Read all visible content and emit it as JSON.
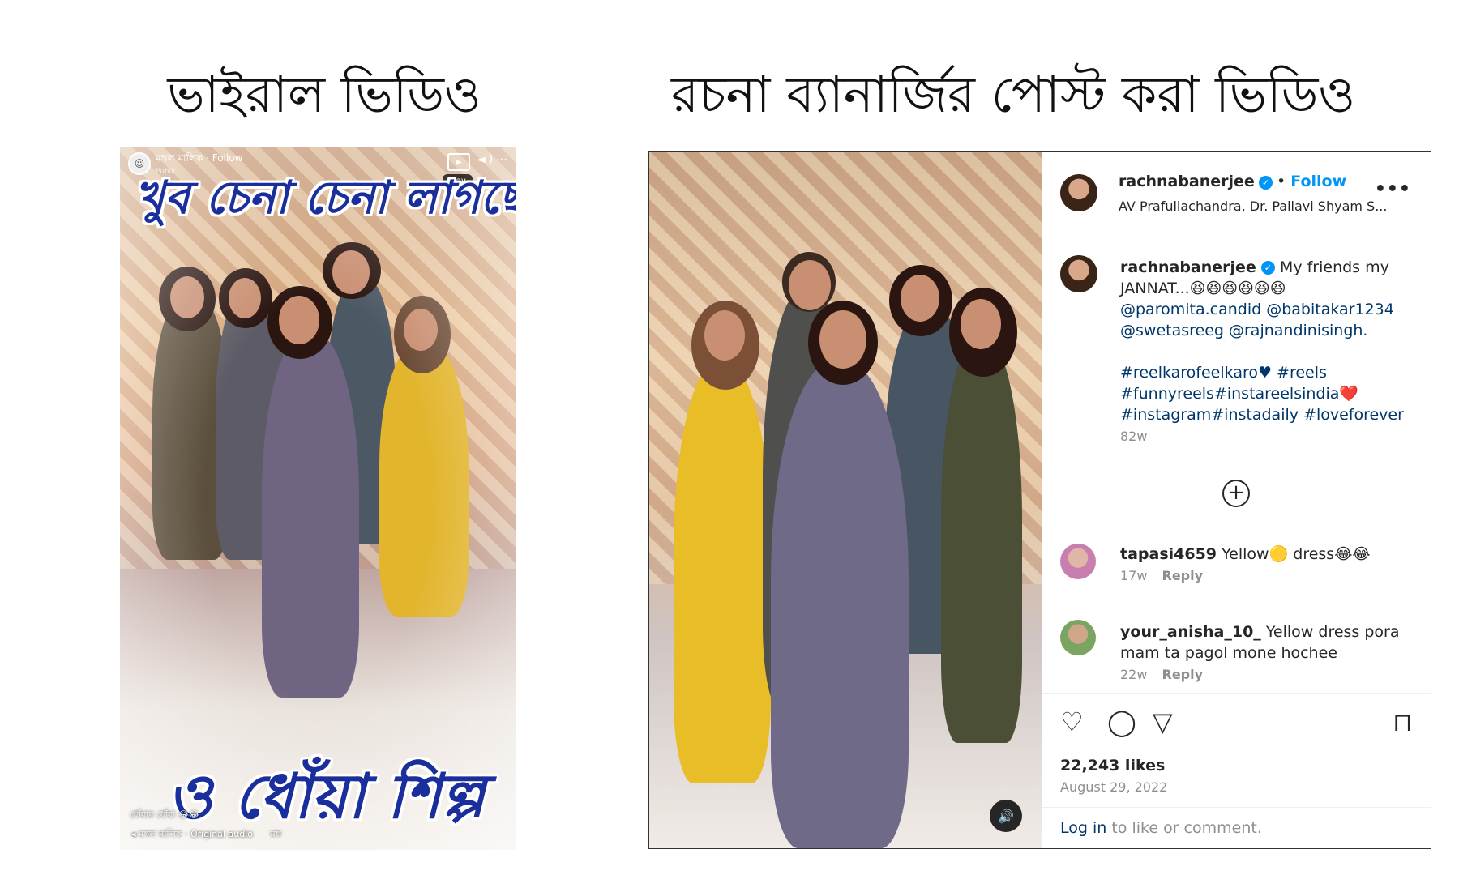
{
  "headings": {
    "left": "ভাইরাল ভিডিও",
    "right": "রচনা ব্যানার্জির পোস্ট করা ভিডিও"
  },
  "viral_video": {
    "page_name": "মঙ্গল মালিক · Follow",
    "visibility": "Public",
    "play_tooltip": "Play",
    "caption_top": "খুব চেনা চেনা লাগছে",
    "caption_bottom": "ও ধোঁয়া শিল্প",
    "footer_caption": "ধোঁয়ার ধোঁয়া 😂😂",
    "footer_audio": "মঙ্গল মালিক · Original audio",
    "footer_extra": "মঙ্গ"
  },
  "instagram": {
    "username": "rachnabanerjee",
    "follow_label": "Follow",
    "location": "AV Prafullachandra, Dr. Pallavi Shyam S...",
    "more_icon": "more-horizontal-icon",
    "caption": {
      "username": "rachnabanerjee",
      "text": "My friends my JANNAT...😆😆😆😆😆😆",
      "mentions_1": "@paromita.candid @babitakar1234",
      "mentions_2": "@swetasreeg @rajnandinisingh.",
      "tags_1": "#reelkarofeelkaro♥ #reels",
      "tags_2": "#funnyreels#instareelsindia❤️",
      "tags_3": "#instagram#instadaily #loveforever",
      "age": "82w"
    },
    "comments": [
      {
        "username": "tapasi4659",
        "text": "Yellow🟡 dress😂😂",
        "age": "17w",
        "reply": "Reply"
      },
      {
        "username": "your_anisha_10_",
        "text": "Yellow dress pora mam ta pagol mone hochee",
        "age": "22w",
        "reply": "Reply"
      }
    ],
    "likes": "22,243 likes",
    "date": "August 29, 2022",
    "login_link": "Log in",
    "login_rest": "to like or comment."
  }
}
